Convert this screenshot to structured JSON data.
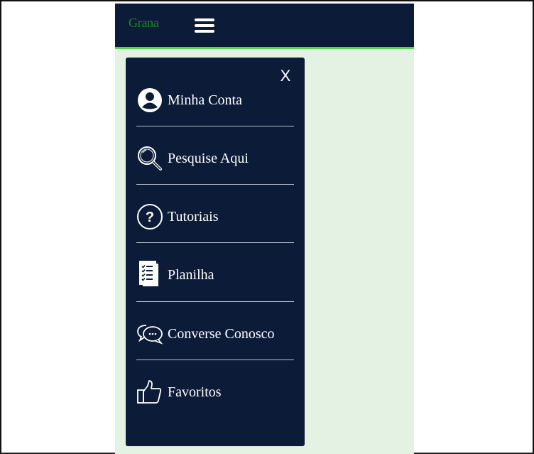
{
  "header": {
    "logo_text": "Grana",
    "logo_color": "#1a8a24",
    "bar_color": "#0c1b38",
    "accent_line_color": "#56d64f"
  },
  "drawer": {
    "close_label": "X",
    "items": [
      {
        "label": "Minha Conta",
        "icon": "user-circle-icon"
      },
      {
        "label": "Pesquise Aqui",
        "icon": "magnifier-icon"
      },
      {
        "label": "Tutoriais",
        "icon": "question-circle-icon"
      },
      {
        "label": "Planilha",
        "icon": "checklist-document-icon"
      },
      {
        "label": "Converse Conosco",
        "icon": "chat-bubbles-icon"
      },
      {
        "label": "Favoritos",
        "icon": "thumbs-up-icon"
      }
    ]
  },
  "page": {
    "background_color": "#e4f2e4"
  }
}
